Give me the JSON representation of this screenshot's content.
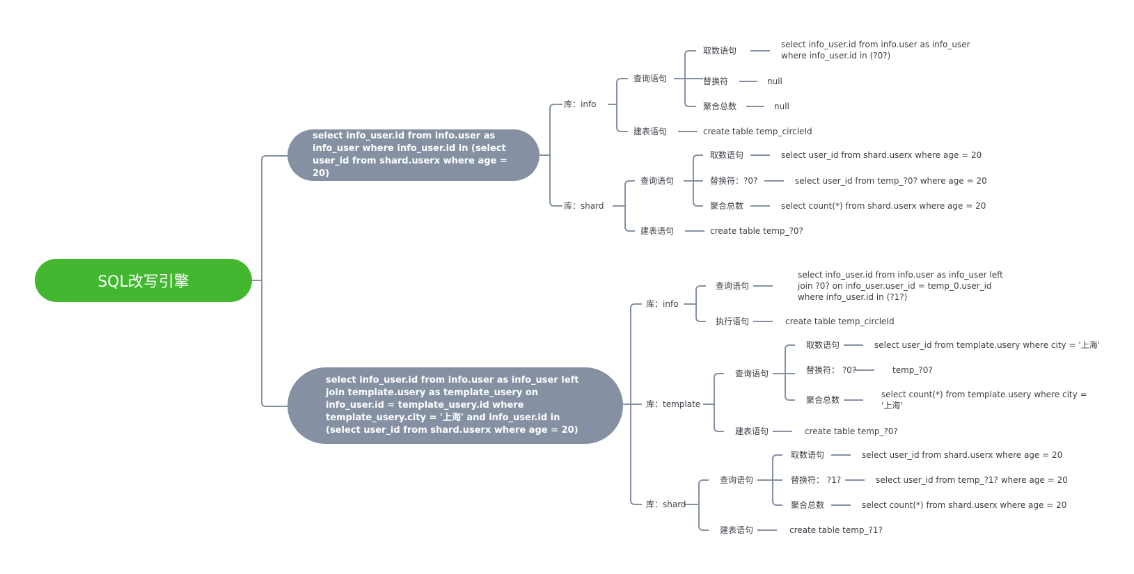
{
  "root": {
    "label": "SQL改写引擎"
  },
  "colors": {
    "root": "#43b72f",
    "branch": "#8591a3",
    "line": "#8591a3",
    "text": "#3b3f46"
  },
  "branches": [
    {
      "label": "select info_user.id from info.user as info_user where info_user.id in (select user_id from shard.userx where age = 20)",
      "dbs": [
        {
          "label": "库：info",
          "query": {
            "label": "查询语句",
            "fetch": {
              "label": "取数语句",
              "value": "select info_user.id from info.user as info_user where info_user.id in (?0?)"
            },
            "replace": {
              "label": "替换符",
              "value": "null"
            },
            "aggregate": {
              "label": "聚合总数",
              "value": "null"
            }
          },
          "create": {
            "label": "建表语句",
            "value": "create table temp_circleId"
          }
        },
        {
          "label": "库：shard",
          "query": {
            "label": "查询语句",
            "fetch": {
              "label": "取数语句",
              "value": "select user_id from shard.userx where age = 20"
            },
            "replace": {
              "label": "替换符：?0?",
              "value": "select user_id from temp_?0? where age = 20"
            },
            "aggregate": {
              "label": "聚合总数",
              "value": "select count(*) from shard.userx where age = 20"
            }
          },
          "create": {
            "label": "建表语句",
            "value": "create table temp_?0?"
          }
        }
      ]
    },
    {
      "label": "select info_user.id from info.user as info_user left join template.usery as template_usery on info_user.id = template_usery.id where template_usery.city = '上海' and info_user.id in (select user_id from shard.userx where age = 20)",
      "dbs": [
        {
          "label": "库：info",
          "query": {
            "label": "查询语句",
            "value": "select info_user.id from info.user as info_user left join ?0?  on info_user.user_id =  temp_0.user_id where info_user.id in (?1?)"
          },
          "exec": {
            "label": "执行语句",
            "value": "create table temp_circleId"
          }
        },
        {
          "label": "库：template",
          "query": {
            "label": "查询语句",
            "fetch": {
              "label": "取数语句",
              "value": "select user_id from template.usery where city = '上海'"
            },
            "replace": {
              "label": "替换符： ?0?",
              "value": "temp_?0?"
            },
            "aggregate": {
              "label": "聚合总数",
              "value": "select count(*) from template.usery where city = '上海'"
            }
          },
          "create": {
            "label": "建表语句",
            "value": "create table temp_?0?"
          }
        },
        {
          "label": "库：shard",
          "query": {
            "label": "查询语句",
            "fetch": {
              "label": "取数语句",
              "value": "select user_id from shard.userx where age = 20"
            },
            "replace": {
              "label": "替换符： ?1?",
              "value": "select user_id from temp_?1? where age = 20"
            },
            "aggregate": {
              "label": "聚合总数",
              "value": "select count(*) from shard.userx where age = 20"
            }
          },
          "create": {
            "label": "建表语句",
            "value": "create table temp_?1?"
          }
        }
      ]
    }
  ]
}
